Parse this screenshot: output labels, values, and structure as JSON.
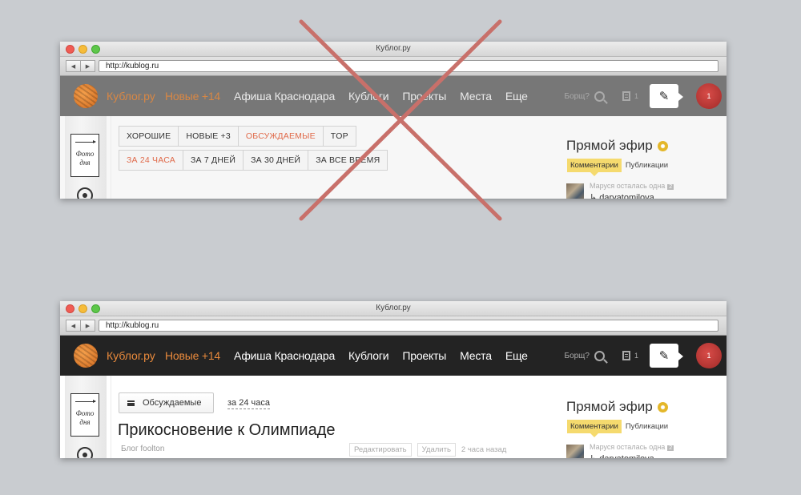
{
  "window": {
    "title": "Кублог.ру",
    "url": "http://kublog.ru",
    "back_glyph": "◀",
    "forward_glyph": "▶"
  },
  "site": {
    "brand": "Кублог.ру",
    "nav_items": {
      "new": "Новые +14",
      "afisha": "Афиша Краснодара",
      "kublogi": "Кублоги",
      "projects": "Проекты",
      "places": "Места",
      "more": "Еще"
    },
    "search_hint": "Борщ?",
    "posts_count": "1",
    "notifications_count": "1",
    "pencil_glyph": "✎"
  },
  "sidebar_left": {
    "photo_of_day_line1": "Фото",
    "photo_of_day_line2": "дня"
  },
  "old_design": {
    "filters_row1": {
      "good": "ХОРОШИЕ",
      "new": "НОВЫЕ +3",
      "discussed": "ОБСУЖДАЕМЫЕ",
      "top": "TOP"
    },
    "filters_row2": {
      "day": "ЗА 24 ЧАСА",
      "week": "ЗА 7 ДНЕЙ",
      "month": "ЗА 30 ДНЕЙ",
      "all": "ЗА ВСЕ ВРЕМЯ"
    }
  },
  "new_design": {
    "sort_button": "Обсуждаемые",
    "period": "за 24 часа",
    "post_title": "Прикосновение к Олимпиаде",
    "post_blog": "Блог foolton",
    "edit": "Редактировать",
    "delete": "Удалить",
    "time_ago": "2 часа назад"
  },
  "live": {
    "title": "Прямой эфир",
    "tab_comments": "Комментарии",
    "tab_posts": "Публикации",
    "comment_text": "Маруся осталась одна",
    "comment_count": "2",
    "comment_user": "↳ daryatomilova"
  },
  "colors": {
    "accent_orange": "#e98a3c",
    "nav_dark": "#232323",
    "cross_red": "#c8706a",
    "tab_yellow": "#f5da6e"
  }
}
